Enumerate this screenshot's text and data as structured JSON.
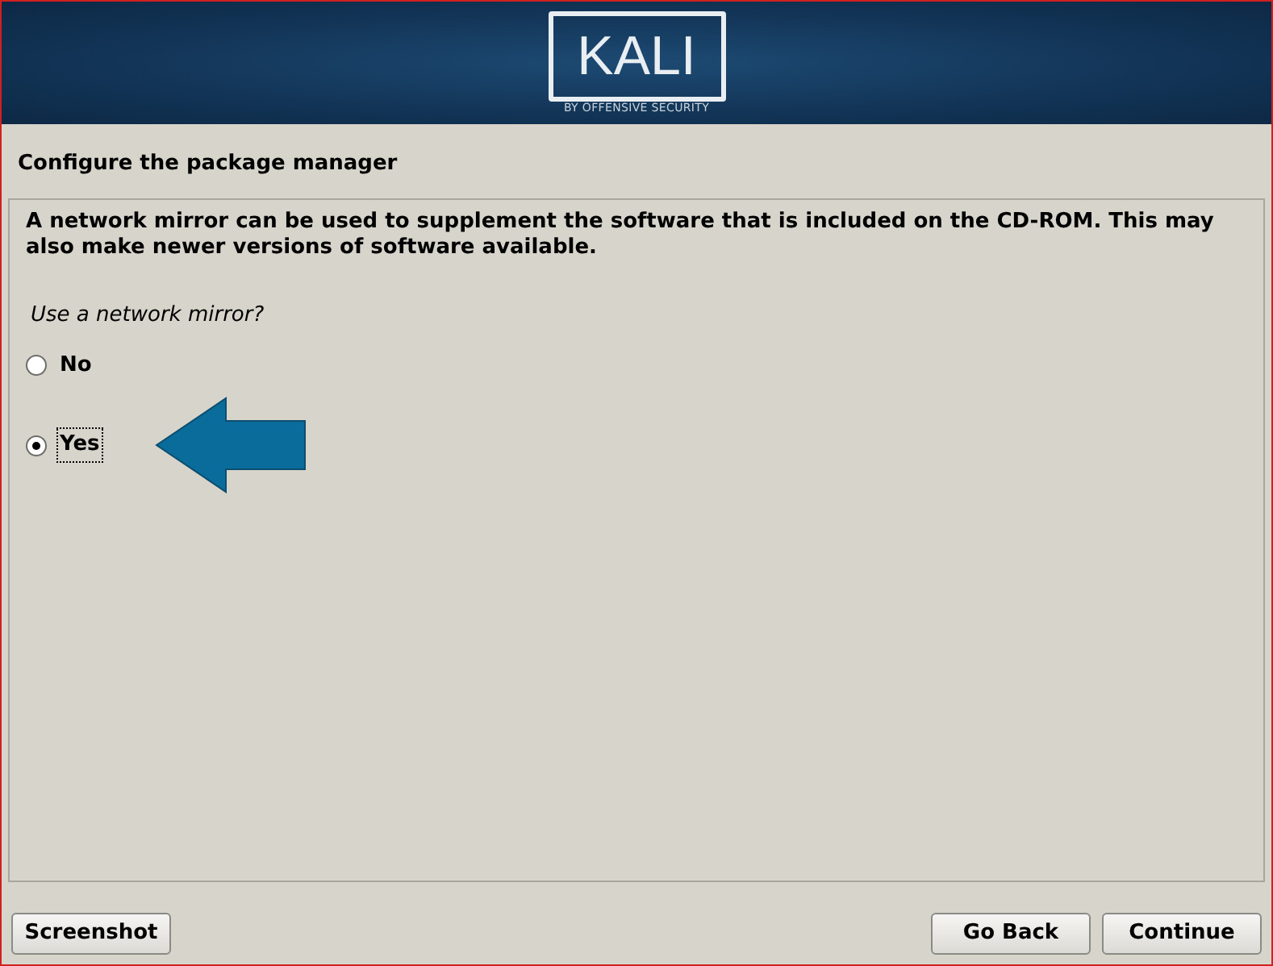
{
  "header": {
    "logo": "KALI",
    "tagline": "BY OFFENSIVE SECURITY"
  },
  "title": "Configure the package manager",
  "description": "A network mirror can be used to supplement the software that is included on the CD-ROM. This may also make newer versions of software available.",
  "question": "Use a network mirror?",
  "options": [
    {
      "label": "No",
      "selected": false
    },
    {
      "label": "Yes",
      "selected": true
    }
  ],
  "buttons": {
    "left": [
      "Screenshot"
    ],
    "right": [
      "Go Back",
      "Continue"
    ]
  }
}
